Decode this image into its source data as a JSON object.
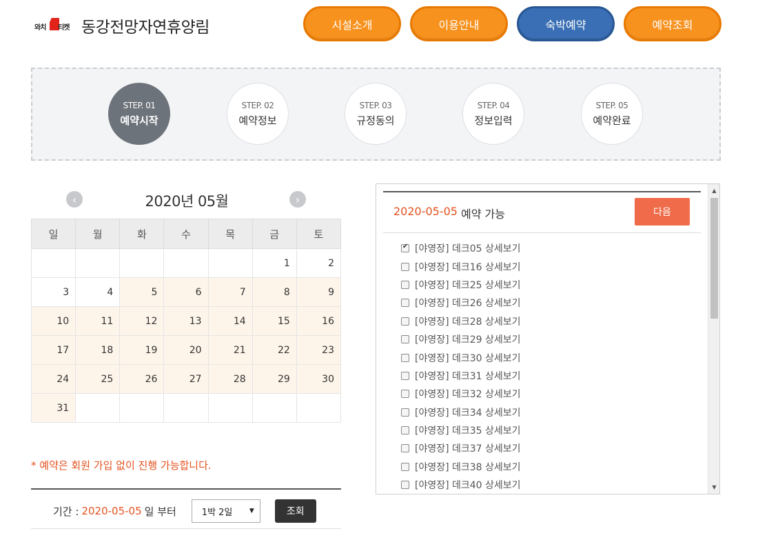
{
  "header": {
    "logo_left": "와치",
    "logo_right": "티켓",
    "site_title": "동강전망자연휴양림",
    "nav": [
      "시설소개",
      "이용안내",
      "숙박예약",
      "예약조회"
    ],
    "active_nav": "숙박예약"
  },
  "steps": [
    {
      "num": "STEP. 01",
      "label": "예약시작",
      "active": true
    },
    {
      "num": "STEP. 02",
      "label": "예약정보",
      "active": false
    },
    {
      "num": "STEP. 03",
      "label": "규정동의",
      "active": false
    },
    {
      "num": "STEP. 04",
      "label": "정보입력",
      "active": false
    },
    {
      "num": "STEP. 05",
      "label": "예약완료",
      "active": false
    }
  ],
  "calendar": {
    "title": "2020년 05월",
    "prev_icon": "chevron-left-icon",
    "next_icon": "chevron-right-icon",
    "weekdays": [
      "일",
      "월",
      "화",
      "수",
      "목",
      "금",
      "토"
    ],
    "weeks": [
      [
        "",
        "",
        "",
        "",
        "",
        "1",
        "2"
      ],
      [
        "3",
        "4",
        "5",
        "6",
        "7",
        "8",
        "9"
      ],
      [
        "10",
        "11",
        "12",
        "13",
        "14",
        "15",
        "16"
      ],
      [
        "17",
        "18",
        "19",
        "20",
        "21",
        "22",
        "23"
      ],
      [
        "24",
        "25",
        "26",
        "27",
        "28",
        "29",
        "30"
      ],
      [
        "31",
        "",
        "",
        "",
        "",
        "",
        ""
      ]
    ],
    "available_days": [
      5,
      6,
      7,
      8,
      9,
      10,
      11,
      12,
      13,
      14,
      15,
      16,
      17,
      18,
      19,
      20,
      21,
      22,
      23,
      24,
      25,
      26,
      27,
      28,
      29,
      30,
      31
    ],
    "available_color": "#fdf5ea"
  },
  "notice": "* 예약은 회원 가입 없이 진행 가능합니다.",
  "period": {
    "label": "기간 :",
    "date": "2020-05-05",
    "suffix": "일 부터",
    "nights_selected": "1박 2일",
    "search_label": "조회"
  },
  "panel": {
    "selected_date": "2020-05-05",
    "status": "예약 가능",
    "next_label": "다음",
    "sites": [
      {
        "label": "[야영장] 데크05 상세보기",
        "checked": true
      },
      {
        "label": "[야영장] 데크16 상세보기",
        "checked": false
      },
      {
        "label": "[야영장] 데크25 상세보기",
        "checked": false
      },
      {
        "label": "[야영장] 데크26 상세보기",
        "checked": false
      },
      {
        "label": "[야영장] 데크28 상세보기",
        "checked": false
      },
      {
        "label": "[야영장] 데크29 상세보기",
        "checked": false
      },
      {
        "label": "[야영장] 데크30 상세보기",
        "checked": false
      },
      {
        "label": "[야영장] 데크31 상세보기",
        "checked": false
      },
      {
        "label": "[야영장] 데크32 상세보기",
        "checked": false
      },
      {
        "label": "[야영장] 데크34 상세보기",
        "checked": false
      },
      {
        "label": "[야영장] 데크35 상세보기",
        "checked": false
      },
      {
        "label": "[야영장] 데크37 상세보기",
        "checked": false
      },
      {
        "label": "[야영장] 데크38 상세보기",
        "checked": false
      },
      {
        "label": "[야영장] 데크40 상세보기",
        "checked": false
      }
    ]
  },
  "colors": {
    "nav_orange": "#f7921e",
    "nav_blue": "#3a6fb5",
    "accent_red": "#e4521f",
    "next_button": "#ef6b4a",
    "step_active": "#6d737a"
  }
}
